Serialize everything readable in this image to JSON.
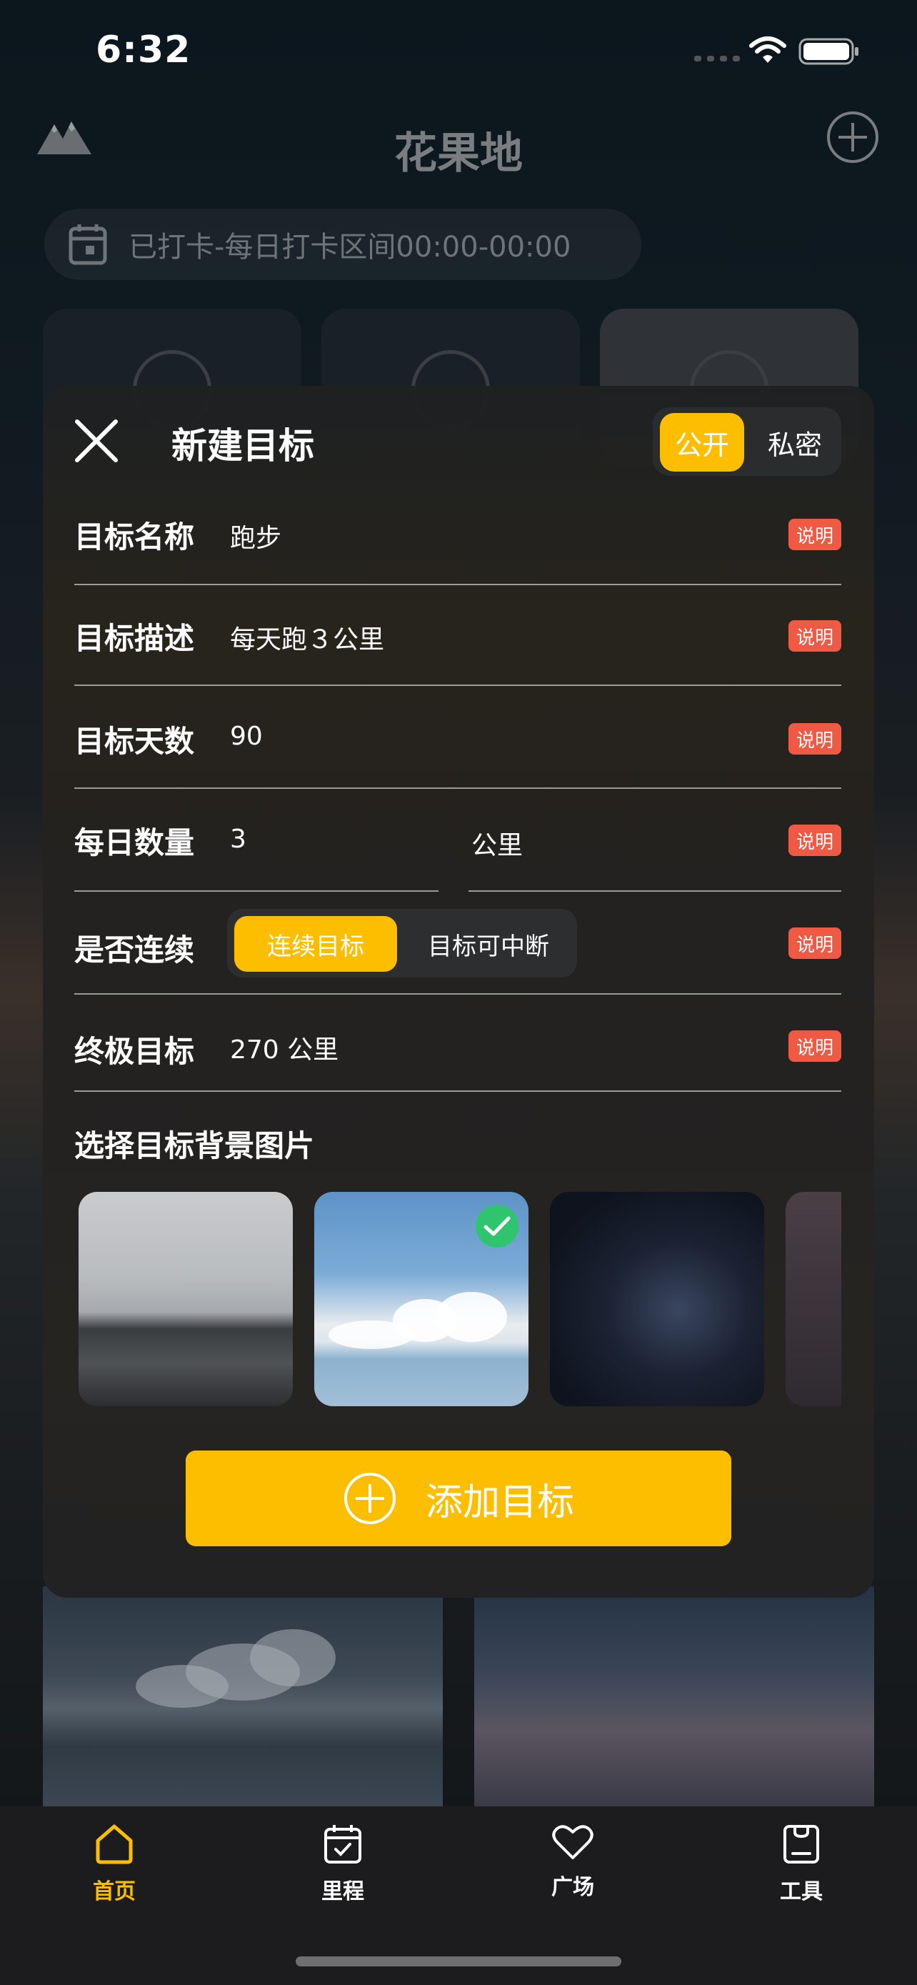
{
  "status": {
    "time": "6:32"
  },
  "header": {
    "title": "花果地",
    "checkin_text": "已打卡-每日打卡区间00:00-00:00"
  },
  "modal": {
    "title": "新建目标",
    "privacy": {
      "public_label": "公开",
      "private_label": "私密",
      "selected": "公开"
    },
    "hint_label": "说明",
    "fields": {
      "name": {
        "label": "目标名称",
        "value": "跑步"
      },
      "description": {
        "label": "目标描述",
        "value": "每天跑３公里"
      },
      "days": {
        "label": "目标天数",
        "value": "90"
      },
      "daily": {
        "label": "每日数量",
        "value": "3",
        "unit": "公里"
      },
      "continuous": {
        "label": "是否连续",
        "option_on": "连续目标",
        "option_off": "目标可中断",
        "selected": "连续目标"
      },
      "ultimate": {
        "label": "终极目标",
        "value": "270 公里"
      }
    },
    "background": {
      "title": "选择目标背景图片",
      "selected_index": 1
    },
    "add_button_label": "添加目标"
  },
  "tabs": [
    {
      "label": "首页",
      "icon": "home-icon",
      "active": true
    },
    {
      "label": "里程",
      "icon": "calendar-check-icon",
      "active": false
    },
    {
      "label": "广场",
      "icon": "heart-icon",
      "active": false
    },
    {
      "label": "工具",
      "icon": "clipboard-icon",
      "active": false
    }
  ],
  "colors": {
    "accent": "#fdbe00",
    "hint": "#f05a45",
    "check": "#2fc56f"
  }
}
